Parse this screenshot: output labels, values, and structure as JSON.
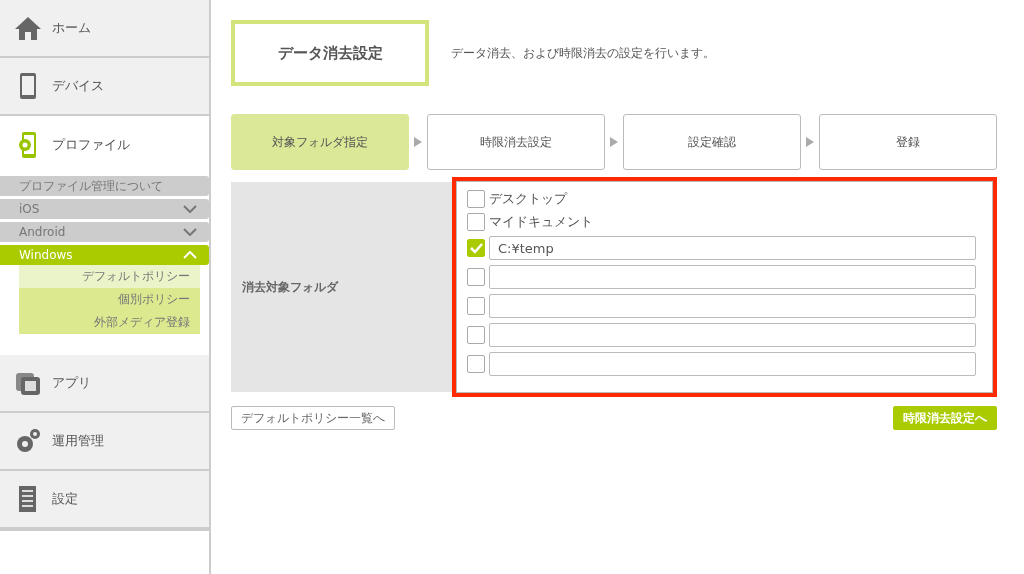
{
  "sidebar": {
    "items": [
      {
        "label": "ホーム",
        "selected": false
      },
      {
        "label": "デバイス",
        "selected": false
      },
      {
        "label": "プロファイル",
        "selected": true,
        "submenu": [
          {
            "kind": "link",
            "label": "プロファイル管理について",
            "selected": false
          },
          {
            "kind": "group",
            "label": "iOS",
            "expanded": false,
            "selected": false
          },
          {
            "kind": "group",
            "label": "Android",
            "expanded": false,
            "selected": false
          },
          {
            "kind": "group",
            "label": "Windows",
            "expanded": true,
            "selected": true,
            "children": [
              {
                "label": "デフォルトポリシー",
                "selected": true
              },
              {
                "label": "個別ポリシー",
                "selected": false
              },
              {
                "label": "外部メディア登録",
                "selected": false
              }
            ]
          }
        ]
      },
      {
        "label": "アプリ",
        "selected": false
      },
      {
        "label": "運用管理",
        "selected": false
      },
      {
        "label": "設定",
        "selected": false
      }
    ]
  },
  "header": {
    "title": "データ消去設定",
    "description": "データ消去、および時限消去の設定を行います。"
  },
  "steps": [
    {
      "label": "対象フォルダ指定",
      "selected": true
    },
    {
      "label": "時限消去設定",
      "selected": false
    },
    {
      "label": "設定確認",
      "selected": false
    },
    {
      "label": "登録",
      "selected": false
    }
  ],
  "form": {
    "label": "消去対象フォルダ",
    "highlighted": true,
    "options": [
      {
        "kind": "check",
        "label": "デスクトップ",
        "checked": false
      },
      {
        "kind": "check",
        "label": "マイドキュメント",
        "checked": false
      },
      {
        "kind": "path",
        "value": "C:¥temp",
        "checked": true
      },
      {
        "kind": "path",
        "checked": false
      },
      {
        "kind": "path",
        "checked": false
      },
      {
        "kind": "path",
        "checked": false
      },
      {
        "kind": "path",
        "checked": false
      }
    ]
  },
  "buttons": {
    "back": "デフォルトポリシー一覧へ",
    "next": "時限消去設定へ"
  }
}
